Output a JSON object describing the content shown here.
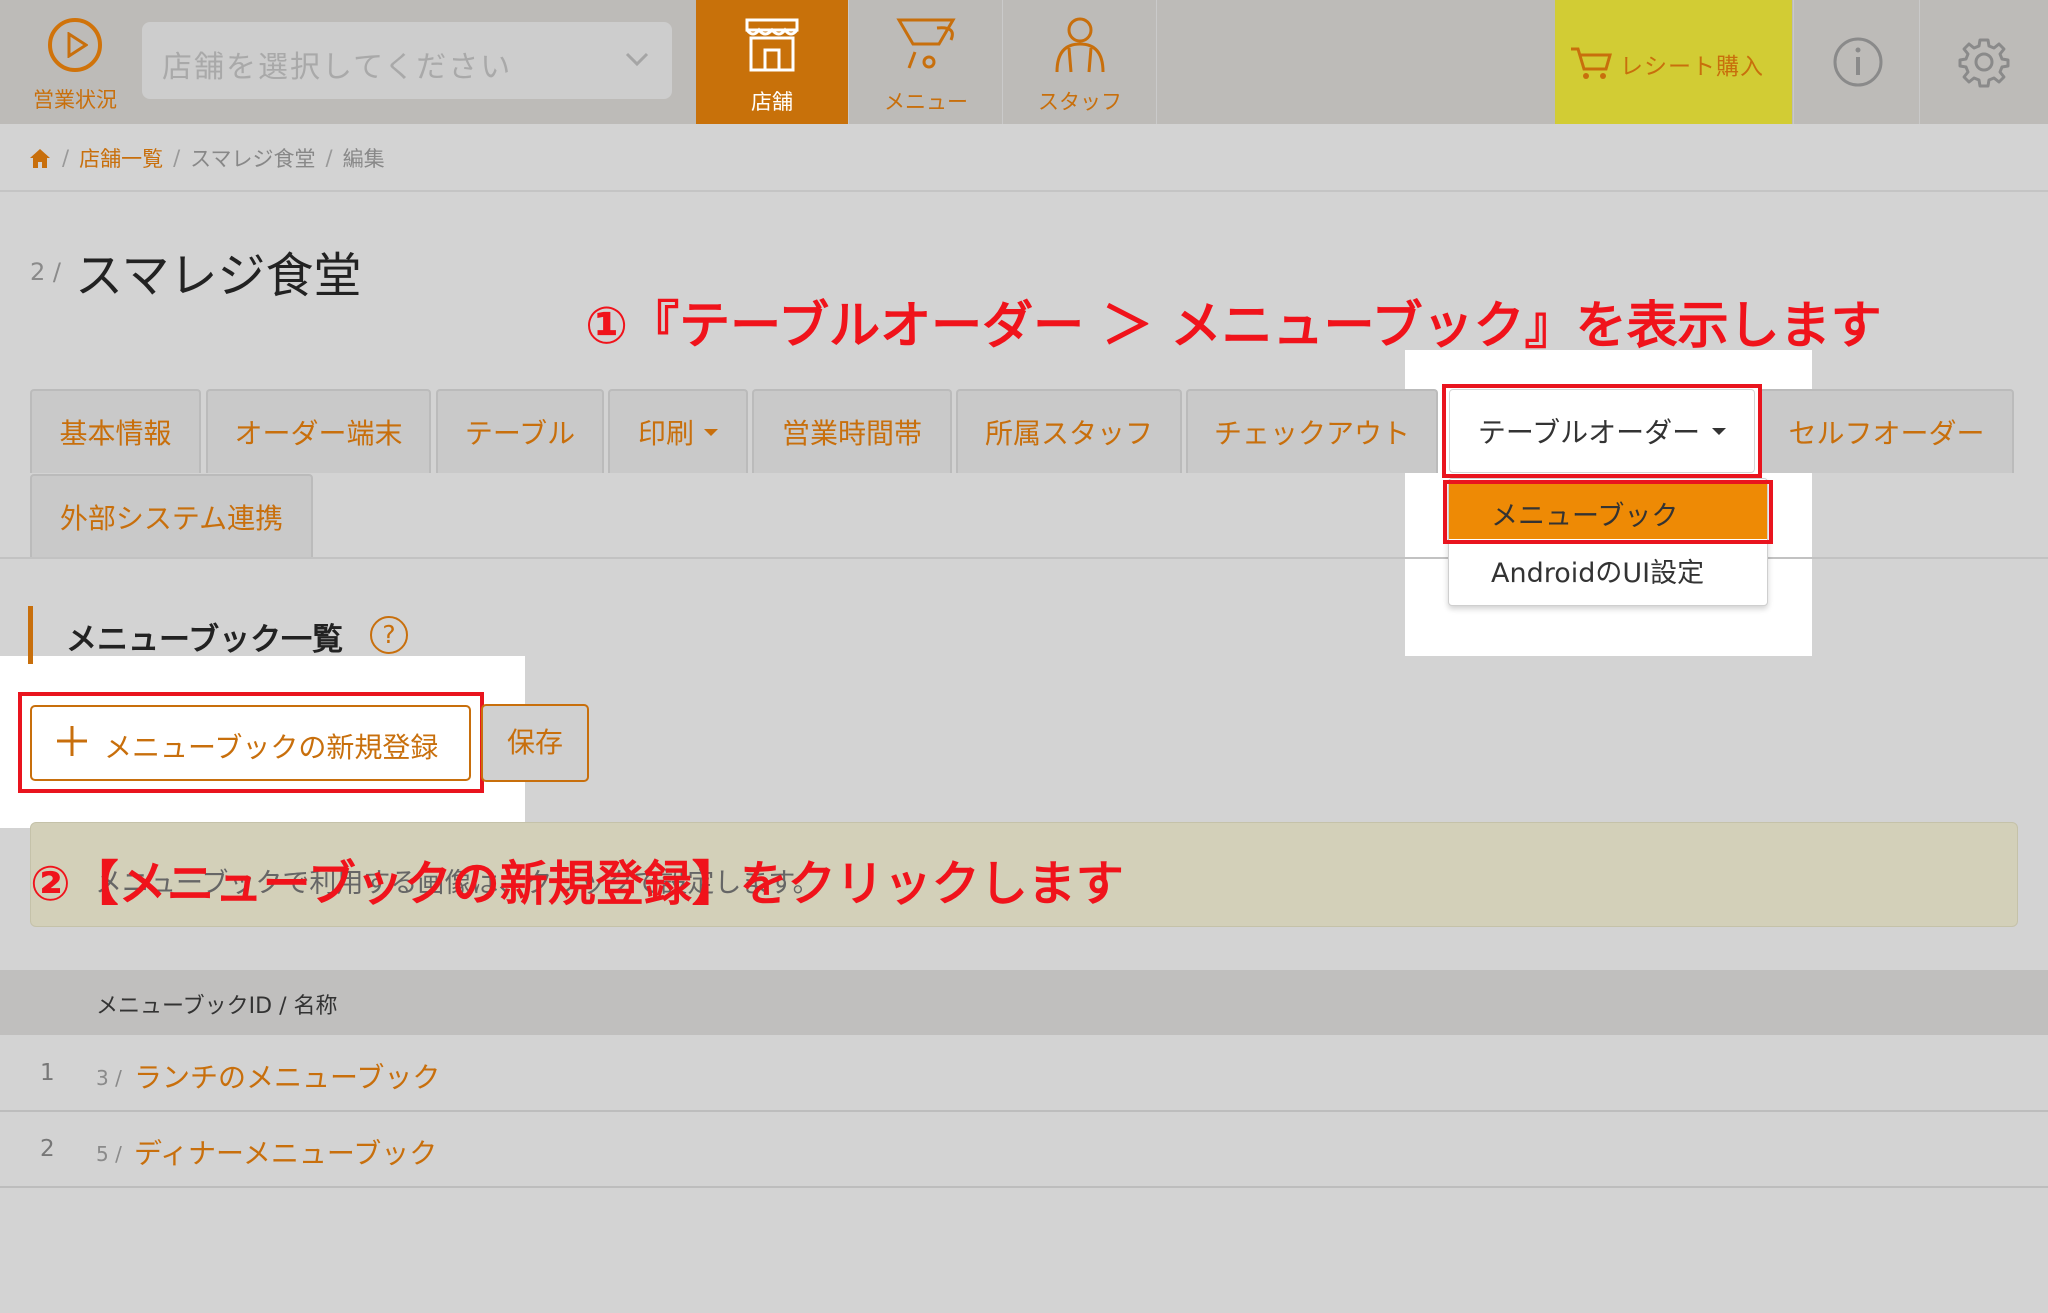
{
  "nav": {
    "status_label": "営業状況",
    "store_placeholder": "店舗を選択してください",
    "tabs": [
      {
        "label": "店舗",
        "icon": "store-icon",
        "active": true
      },
      {
        "label": "メニュー",
        "icon": "menu-cup-icon",
        "active": false
      },
      {
        "label": "スタッフ",
        "icon": "staff-icon",
        "active": false
      }
    ],
    "receipt_label": "レシート購入"
  },
  "breadcrumb": {
    "home_icon": "home-icon",
    "items": [
      "店舗一覧",
      "スマレジ食堂",
      "編集"
    ]
  },
  "page": {
    "id": "2 /",
    "title": "スマレジ食堂"
  },
  "annotations": {
    "step1": "①『テーブルオーダー ＞ メニューブック』を表示します",
    "step2": "②【メニューブックの新規登録】をクリックします"
  },
  "tabs": [
    {
      "label": "基本情報"
    },
    {
      "label": "オーダー端末"
    },
    {
      "label": "テーブル"
    },
    {
      "label": "印刷"
    },
    {
      "label": "営業時間帯"
    },
    {
      "label": "所属スタッフ"
    },
    {
      "label": "チェックアウト"
    },
    {
      "label": "テーブルオーダー"
    },
    {
      "label": "セルフオーダー"
    },
    {
      "label": "外部システム連携"
    }
  ],
  "dropdown": {
    "items": [
      "メニューブック",
      "AndroidのUI設定"
    ]
  },
  "section": {
    "title": "メニューブック一覧",
    "help": "?",
    "new_button": "メニューブックの新規登録",
    "save_button": "保存",
    "notice": "メニューブックで利用する画像は、クリックで設定します。"
  },
  "table": {
    "header": "メニューブックID / 名称",
    "rows": [
      {
        "no": "1",
        "id": "3 /",
        "name": "ランチのメニューブック"
      },
      {
        "no": "2",
        "id": "5 /",
        "name": "ディナーメニューブック"
      }
    ]
  },
  "colors": {
    "accent": "#c86f0c",
    "annotation": "#f0131b",
    "receipt": "#d2cc34"
  }
}
